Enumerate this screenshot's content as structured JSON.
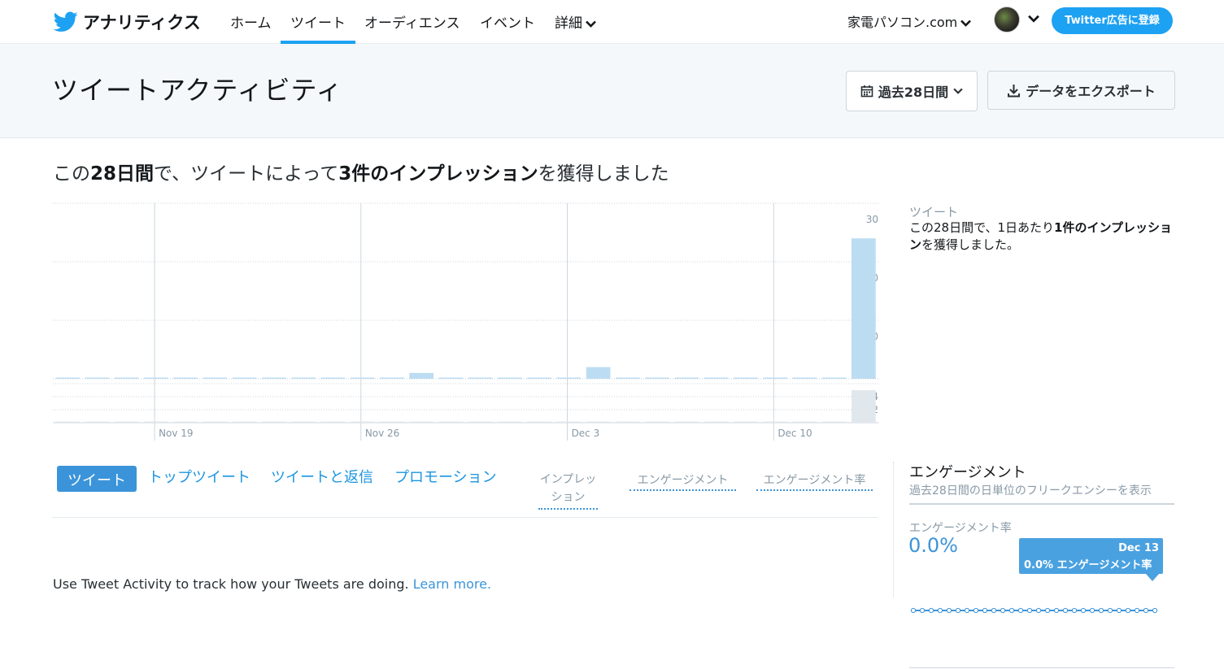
{
  "nav": {
    "brand": "アナリティクス",
    "items": [
      "ホーム",
      "ツイート",
      "オーディエンス",
      "イベント",
      "詳細"
    ],
    "active_index": 1,
    "account": "家電パソコン.com",
    "ads_button": "Twitter広告に登録"
  },
  "header": {
    "title": "ツイートアクティビティ",
    "range_label": "過去28日間",
    "export_label": "データをエクスポート"
  },
  "summary": {
    "prefix": "この",
    "period": "28日間",
    "middle": "で、ツイートによって",
    "count": "3件のインプレッション",
    "suffix": "を獲得しました"
  },
  "side": {
    "label": "ツイート",
    "text_prefix": "この28日間で、1日あたり",
    "text_bold": "1件のインプレッション",
    "text_suffix": "を獲得しました。"
  },
  "tabs": {
    "items": [
      "ツイート",
      "トップツイート",
      "ツイートと返信",
      "プロモーション"
    ],
    "active_index": 0,
    "columns": [
      "インプレッション",
      "エンゲージメント",
      "エンゲージメント率"
    ]
  },
  "empty": {
    "message": "Use Tweet Activity to track how your Tweets are doing.",
    "link": "Learn more."
  },
  "engagement": {
    "title": "エンゲージメント",
    "subtitle": "過去28日間の日単位のフリークエンシーを表示",
    "rate_label": "エンゲージメント率",
    "rate_value": "0.0%",
    "tooltip_date": "Dec 13",
    "tooltip_value": "0.0% エンゲージメント率",
    "spark_points": 28,
    "spark_value": 0
  },
  "colors": {
    "accent": "#1da1f2",
    "link": "#3b94d9",
    "bar": "#bcdcf2",
    "bar_lower": "#e1e8ed"
  },
  "chart_data": {
    "type": "bar",
    "x_tick_labels": [
      "Nov 19",
      "Nov 26",
      "Dec 3",
      "Dec 10"
    ],
    "y_ticks_upper": [
      10,
      20,
      30
    ],
    "y_ticks_lower": [
      2,
      4
    ],
    "upper_series": {
      "name": "",
      "values": [
        0,
        0,
        0,
        0,
        0,
        0,
        0,
        0,
        0,
        0,
        0,
        0,
        1,
        0,
        0,
        0,
        0,
        0,
        2,
        0,
        0,
        0,
        0,
        0,
        0,
        0,
        0,
        24
      ]
    },
    "lower_series": {
      "name": "",
      "values": [
        0,
        0,
        0,
        0,
        0,
        0,
        0,
        0,
        0,
        0,
        0,
        0,
        0,
        0,
        0,
        0,
        0,
        0,
        0,
        0,
        0,
        0,
        0,
        0,
        0,
        0,
        0,
        5
      ]
    }
  }
}
